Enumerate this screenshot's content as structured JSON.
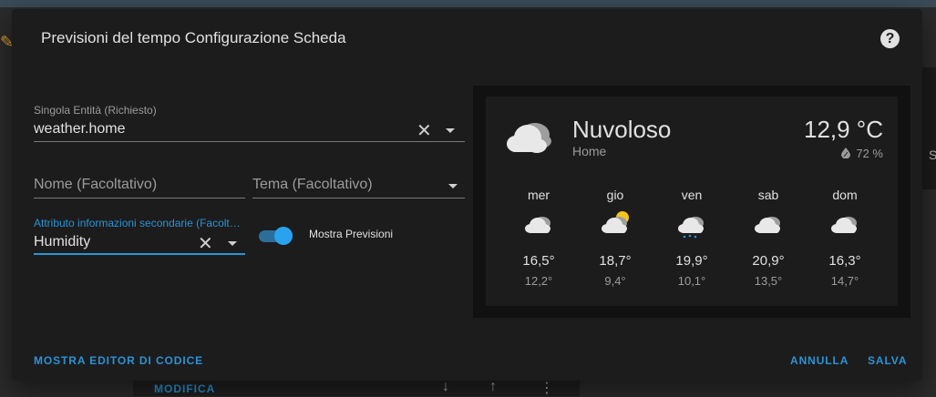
{
  "dialog": {
    "title": "Previsioni del tempo Configurazione Scheda",
    "help_icon": "help-circle-icon"
  },
  "form": {
    "entity": {
      "label": "Singola Entità (Richiesto)",
      "value": "weather.home"
    },
    "name": {
      "placeholder": "Nome (Facoltativo)"
    },
    "theme": {
      "placeholder": "Tema (Facoltativo)"
    },
    "secondary_info": {
      "label": "Attributo informazioni secondarie (Facoltativo)",
      "value": "Humidity"
    },
    "show_forecast": {
      "label": "Mostra Previsioni",
      "checked": true
    }
  },
  "actions": {
    "code_editor": "MOSTRA EDITOR DI CODICE",
    "cancel": "ANNULLA",
    "save": "SALVA"
  },
  "weather": {
    "condition": "Nuvoloso",
    "location": "Home",
    "temperature": "12,9 °C",
    "humidity": "72 %",
    "forecast": [
      {
        "day": "mer",
        "icon": "cloudy-icon",
        "high": "16,5°",
        "low": "12,2°"
      },
      {
        "day": "gio",
        "icon": "partly-cloudy-icon",
        "high": "18,7°",
        "low": "9,4°"
      },
      {
        "day": "ven",
        "icon": "rainy-icon",
        "high": "19,9°",
        "low": "10,1°"
      },
      {
        "day": "sab",
        "icon": "cloudy-icon",
        "high": "20,9°",
        "low": "13,5°"
      },
      {
        "day": "dom",
        "icon": "cloudy-icon",
        "high": "16,3°",
        "low": "14,7°"
      }
    ]
  },
  "background": {
    "modify_label": "MODIFICA"
  },
  "colors": {
    "accent": "#2a93d5",
    "dialog_bg": "#1c1c1c",
    "sun": "#f5c518"
  }
}
